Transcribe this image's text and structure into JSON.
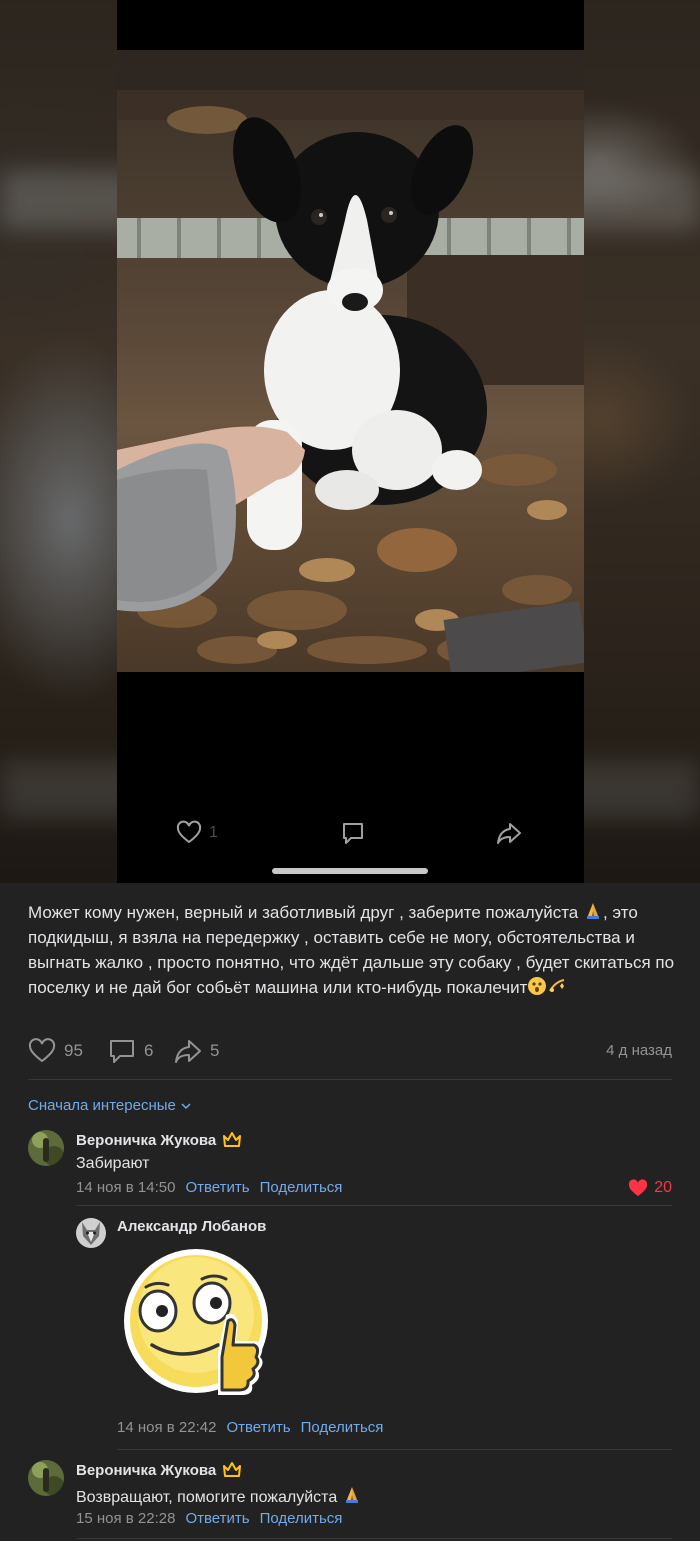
{
  "viewer": {
    "like_count": "1",
    "like_icon": "heart-outline-icon",
    "comment_icon": "comment-icon",
    "share_icon": "share-icon"
  },
  "post": {
    "text_parts": [
      "Может кому нужен, верный и заботливый друг , заберите пожалуйста ",
      ", это подкидыш, я взяла на передержку , оставить себе не могу, обстоятельства и выгнать жалко , просто понятно, что ждёт дальше эту собаку , будет скитаться по поселку и не дай бог собьёт машина или кто-нибудь покалечит"
    ],
    "likes": "95",
    "comments": "6",
    "shares": "5",
    "time": "4 д назад"
  },
  "comments_sort": "Сначала интересные",
  "comments": [
    {
      "author": "Вероничка Жукова",
      "text": "Забирают",
      "time": "14 ноя в 14:50",
      "reply_label": "Ответить",
      "share_label": "Поделиться",
      "likes": "20"
    },
    {
      "author": "Александр Лобанов",
      "sticker": "thumbs-up-smiley-sticker",
      "time": "14 ноя в 22:42",
      "reply_label": "Ответить",
      "share_label": "Поделиться"
    },
    {
      "author": "Вероничка Жукова",
      "text": "Возвращают, помогите пожалуйста",
      "time": "15 ноя в 22:28",
      "reply_label": "Ответить",
      "share_label": "Поделиться"
    }
  ],
  "colors": {
    "background": "#222222",
    "link": "#71aaeb",
    "muted": "#939393",
    "like_active": "#ff3347",
    "crown": "#ffc11a"
  }
}
